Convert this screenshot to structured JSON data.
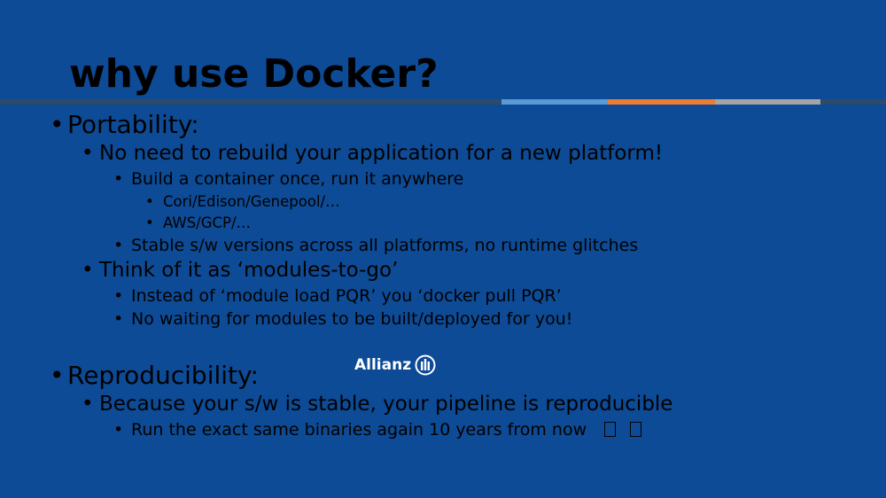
{
  "slide": {
    "title": "why use Docker?",
    "rule_colors": {
      "dark": "#2d4a6b",
      "blue": "#5b9bd5",
      "orange": "#ed7d31",
      "gray": "#a5a5a5"
    },
    "background": "#0d4b96"
  },
  "bullets": [
    {
      "level": 1,
      "text": "Portability:"
    },
    {
      "level": 2,
      "text": "No need to rebuild your application for a new platform!"
    },
    {
      "level": 3,
      "text": "Build a container once, run it anywhere"
    },
    {
      "level": 4,
      "text": "Cori/Edison/Genepool/…"
    },
    {
      "level": 4,
      "text": "AWS/GCP/…"
    },
    {
      "level": 3,
      "text": "Stable s/w versions across all platforms, no runtime glitches"
    },
    {
      "level": 2,
      "text": "Think of it as ‘modules-to-go’"
    },
    {
      "level": 3,
      "text": "Instead of ‘module load PQR’ you ‘docker pull PQR’"
    },
    {
      "level": 3,
      "text": "No waiting for modules to be built/deployed for you!"
    },
    {
      "level": 1,
      "text": "Reproducibility:"
    },
    {
      "level": 2,
      "text": "Because your s/w is stable, your pipeline is reproducible"
    },
    {
      "level": 3,
      "text": "Run the exact same binaries again 10 years from now"
    }
  ],
  "bullet_symbol": "•",
  "logo": {
    "text": "Allianz",
    "icon": "allianz-logo-icon"
  }
}
